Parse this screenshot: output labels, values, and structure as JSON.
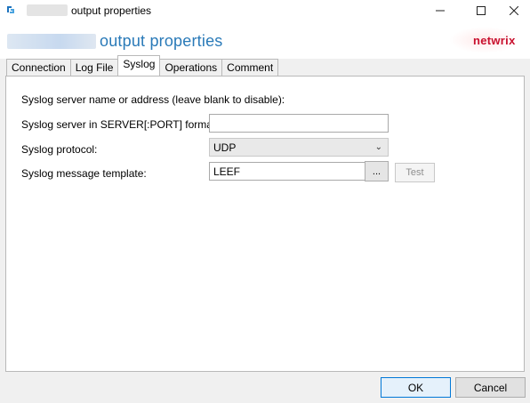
{
  "window": {
    "title": "output properties",
    "header_title": "output properties",
    "brand": "netwrix"
  },
  "tabs": [
    {
      "label": "Connection",
      "active": false
    },
    {
      "label": "Log File",
      "active": false
    },
    {
      "label": "Syslog",
      "active": true
    },
    {
      "label": "Operations",
      "active": false
    },
    {
      "label": "Comment",
      "active": false
    }
  ],
  "syslog": {
    "intro": "Syslog server name or address (leave blank to disable):",
    "server_label": "Syslog server in SERVER[:PORT] format:",
    "server_value": "",
    "protocol_label": "Syslog protocol:",
    "protocol_value": "UDP",
    "template_label": "Syslog message template:",
    "template_value": "LEEF",
    "browse_label": "...",
    "test_label": "Test"
  },
  "footer": {
    "ok_label": "OK",
    "cancel_label": "Cancel"
  },
  "colors": {
    "accent": "#2a7ab8",
    "brand": "#c8102e",
    "default_button_border": "#0078d7"
  }
}
